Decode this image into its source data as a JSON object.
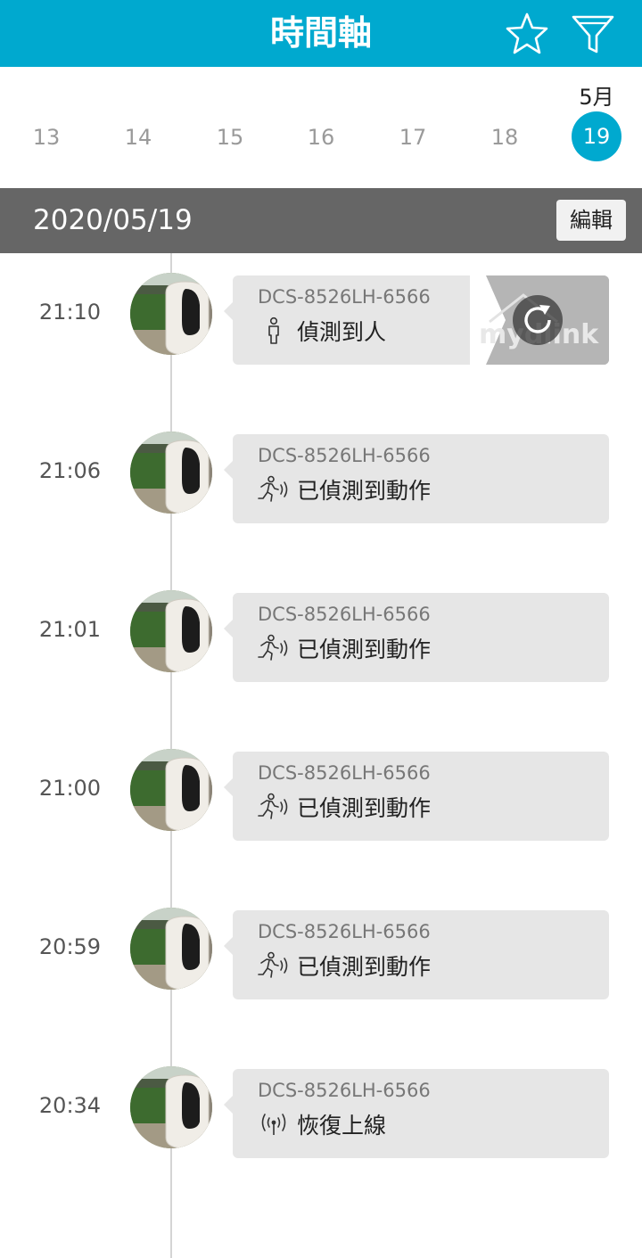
{
  "header": {
    "title": "時間軸",
    "icons": [
      "star-icon",
      "filter-icon"
    ]
  },
  "date_strip": {
    "month": "5月",
    "days": [
      "13",
      "14",
      "15",
      "16",
      "17",
      "18",
      "19"
    ],
    "selected_day": "19"
  },
  "date_bar": {
    "date": "2020/05/19",
    "edit_label": "編輯"
  },
  "events": [
    {
      "time": "21:10",
      "device": "DCS-8526LH-6566",
      "type": "偵測到人",
      "icon": "person-icon",
      "preview_logo": "mydlink",
      "preview_icon": "refresh-icon"
    },
    {
      "time": "21:06",
      "device": "DCS-8526LH-6566",
      "type": "已偵測到動作",
      "icon": "motion-icon"
    },
    {
      "time": "21:01",
      "device": "DCS-8526LH-6566",
      "type": "已偵測到動作",
      "icon": "motion-icon"
    },
    {
      "time": "21:00",
      "device": "DCS-8526LH-6566",
      "type": "已偵測到動作",
      "icon": "motion-icon"
    },
    {
      "time": "20:59",
      "device": "DCS-8526LH-6566",
      "type": "已偵測到動作",
      "icon": "motion-icon"
    },
    {
      "time": "20:34",
      "device": "DCS-8526LH-6566",
      "type": "恢復上線",
      "icon": "online-signal-icon"
    }
  ],
  "colors": {
    "accent": "#00a9cf",
    "date_bar": "#666666",
    "card": "#e6e6e6"
  }
}
